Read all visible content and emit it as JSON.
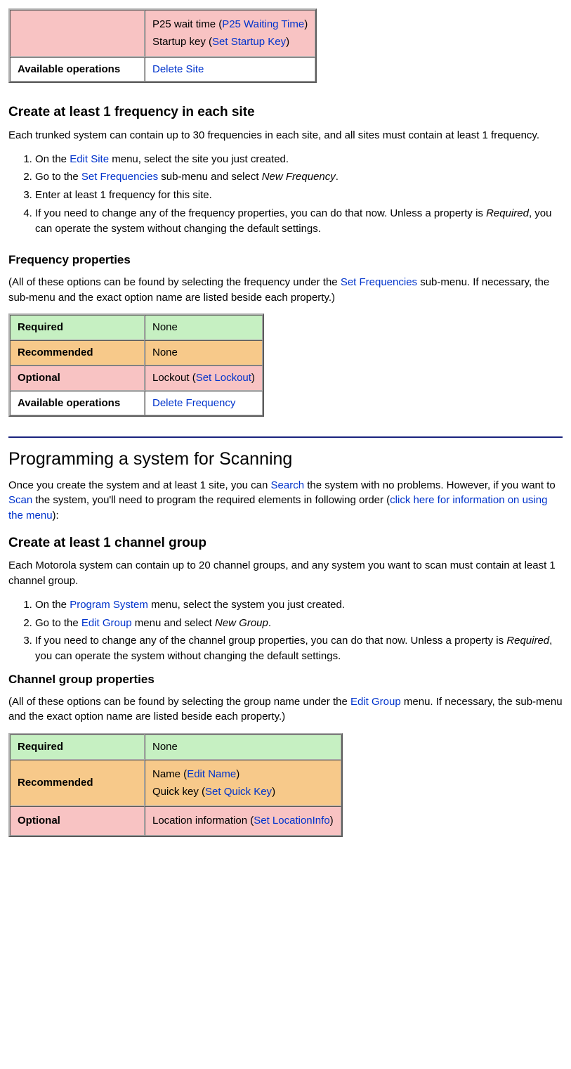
{
  "table1": {
    "pink_line1_prefix": "P25 wait time (",
    "pink_line1_link": "P25 Waiting Time",
    "pink_line2_prefix": "Startup key (",
    "pink_line2_link": "Set Startup Key",
    "avail_label": "Available operations",
    "avail_link": "Delete Site"
  },
  "freq_section": {
    "heading": "Create at least 1 frequency in each site",
    "intro": "Each trunked system can contain up to 30 frequencies in each site, and all sites must contain at least 1 frequency.",
    "step1_a": "On the ",
    "step1_link": "Edit Site",
    "step1_b": " menu, select the site you just created.",
    "step2_a": "Go to the ",
    "step2_link": "Set Frequencies",
    "step2_b": " sub-menu and select ",
    "step2_em": "New Frequency",
    "step2_c": ".",
    "step3": "Enter at least 1 frequency for this site.",
    "step4_a": "If you need to change any of the frequency properties, you can do that now. Unless a property is ",
    "step4_em": "Required",
    "step4_b": ", you can operate the system without changing the default settings."
  },
  "freq_props": {
    "heading": "Frequency properties",
    "note_a": "(All of these options can be found by selecting the frequency under the ",
    "note_link": "Set Frequencies",
    "note_b": " sub-menu. If necessary, the sub-menu and the exact option name are listed beside each property.)",
    "required_label": "Required",
    "required_val": "None",
    "recommended_label": "Recommended",
    "recommended_val": "None",
    "optional_label": "Optional",
    "optional_prefix": "Lockout (",
    "optional_link": "Set Lockout",
    "avail_label": "Available operations",
    "avail_link": "Delete Frequency"
  },
  "scan": {
    "heading": "Programming a system for Scanning",
    "p_a": "Once you create the system and at least 1 site, you can ",
    "p_link1": "Search",
    "p_b": " the system with no problems. However, if you want to ",
    "p_link2": "Scan",
    "p_c": " the system, you'll need to program the required elements in following order (",
    "p_link3": "click here for information on using the menu",
    "p_d": "):"
  },
  "group_section": {
    "heading": "Create at least 1 channel group",
    "intro": "Each Motorola system can contain up to 20 channel groups, and any system you want to scan must contain at least 1 channel group.",
    "step1_a": "On the ",
    "step1_link": "Program System",
    "step1_b": " menu, select the system you just created.",
    "step2_a": "Go to the ",
    "step2_link": "Edit Group",
    "step2_b": " menu and select ",
    "step2_em": "New Group",
    "step2_c": ".",
    "step3_a": "If you need to change any of the channel group properties, you can do that now. Unless a property is ",
    "step3_em": "Required",
    "step3_b": ", you can operate the system without changing the default settings."
  },
  "group_props": {
    "heading": "Channel group properties",
    "note_a": "(All of these options can be found by selecting the group name under the ",
    "note_link": "Edit Group",
    "note_b": " menu. If necessary, the sub-menu and the exact option name are listed beside each property.)",
    "required_label": "Required",
    "required_val": "None",
    "recommended_label": "Recommended",
    "rec_line1_prefix": "Name (",
    "rec_line1_link": "Edit Name",
    "rec_line2_prefix": "Quick key (",
    "rec_line2_link": "Set Quick Key",
    "optional_label": "Optional",
    "opt_line1_prefix": "Location information (",
    "opt_line1_link": "Set LocationInfo"
  }
}
